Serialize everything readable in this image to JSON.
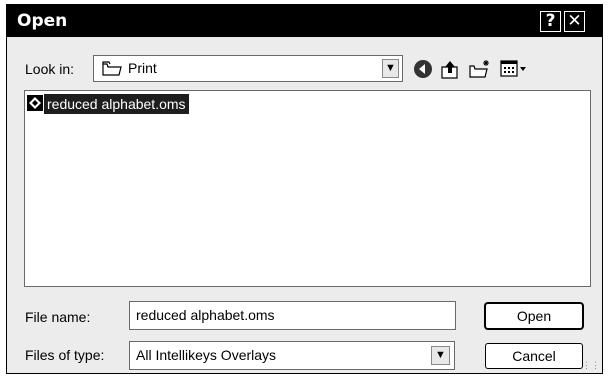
{
  "window": {
    "title": "Open",
    "help_label": "?",
    "close_label": "✕"
  },
  "lookin": {
    "label": "Look in:",
    "value": "Print",
    "icon": "folder-icon"
  },
  "toolbar": {
    "icons": [
      "back-icon",
      "up-folder-icon",
      "new-folder-icon",
      "views-menu-icon"
    ]
  },
  "files": [
    {
      "name": "reduced alphabet.oms",
      "icon": "overlay-file-icon",
      "selected": true
    }
  ],
  "filename": {
    "label": "File name:",
    "value": "reduced alphabet.oms"
  },
  "filetype": {
    "label": "Files of type:",
    "value": "All Intellikeys Overlays"
  },
  "buttons": {
    "open": "Open",
    "cancel": "Cancel"
  },
  "colors": {
    "titlebar": "#000000",
    "selection": "#1e1e1e",
    "dialog_bg": "#ececec"
  }
}
